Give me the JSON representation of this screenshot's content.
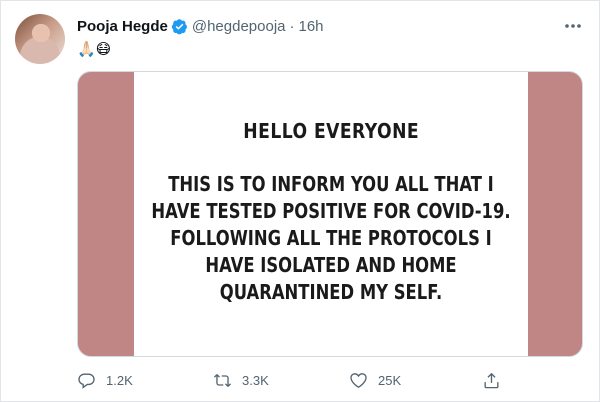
{
  "tweet": {
    "display_name": "Pooja Hegde",
    "handle": "@hegdepooja",
    "separator": "·",
    "time": "16h",
    "text": "🙏🏻😷",
    "verified": true
  },
  "media": {
    "heading": "HELLO EVERYONE",
    "body": "THIS IS TO INFORM YOU ALL THAT I\nHAVE TESTED POSITIVE FOR COVID-19.\nFOLLOWING ALL THE PROTOCOLS I\nHAVE ISOLATED AND HOME\nQUARANTINED MY SELF.",
    "side_color": "#c08585"
  },
  "actions": {
    "replies": "1.2K",
    "retweets": "3.3K",
    "likes": "25K"
  },
  "icons": {
    "verified": "verified-badge-icon",
    "more": "more-dots-icon",
    "reply": "reply-icon",
    "retweet": "retweet-icon",
    "like": "heart-icon",
    "share": "share-icon"
  },
  "colors": {
    "verified_blue": "#1d9bf0",
    "secondary_text": "#536471"
  }
}
